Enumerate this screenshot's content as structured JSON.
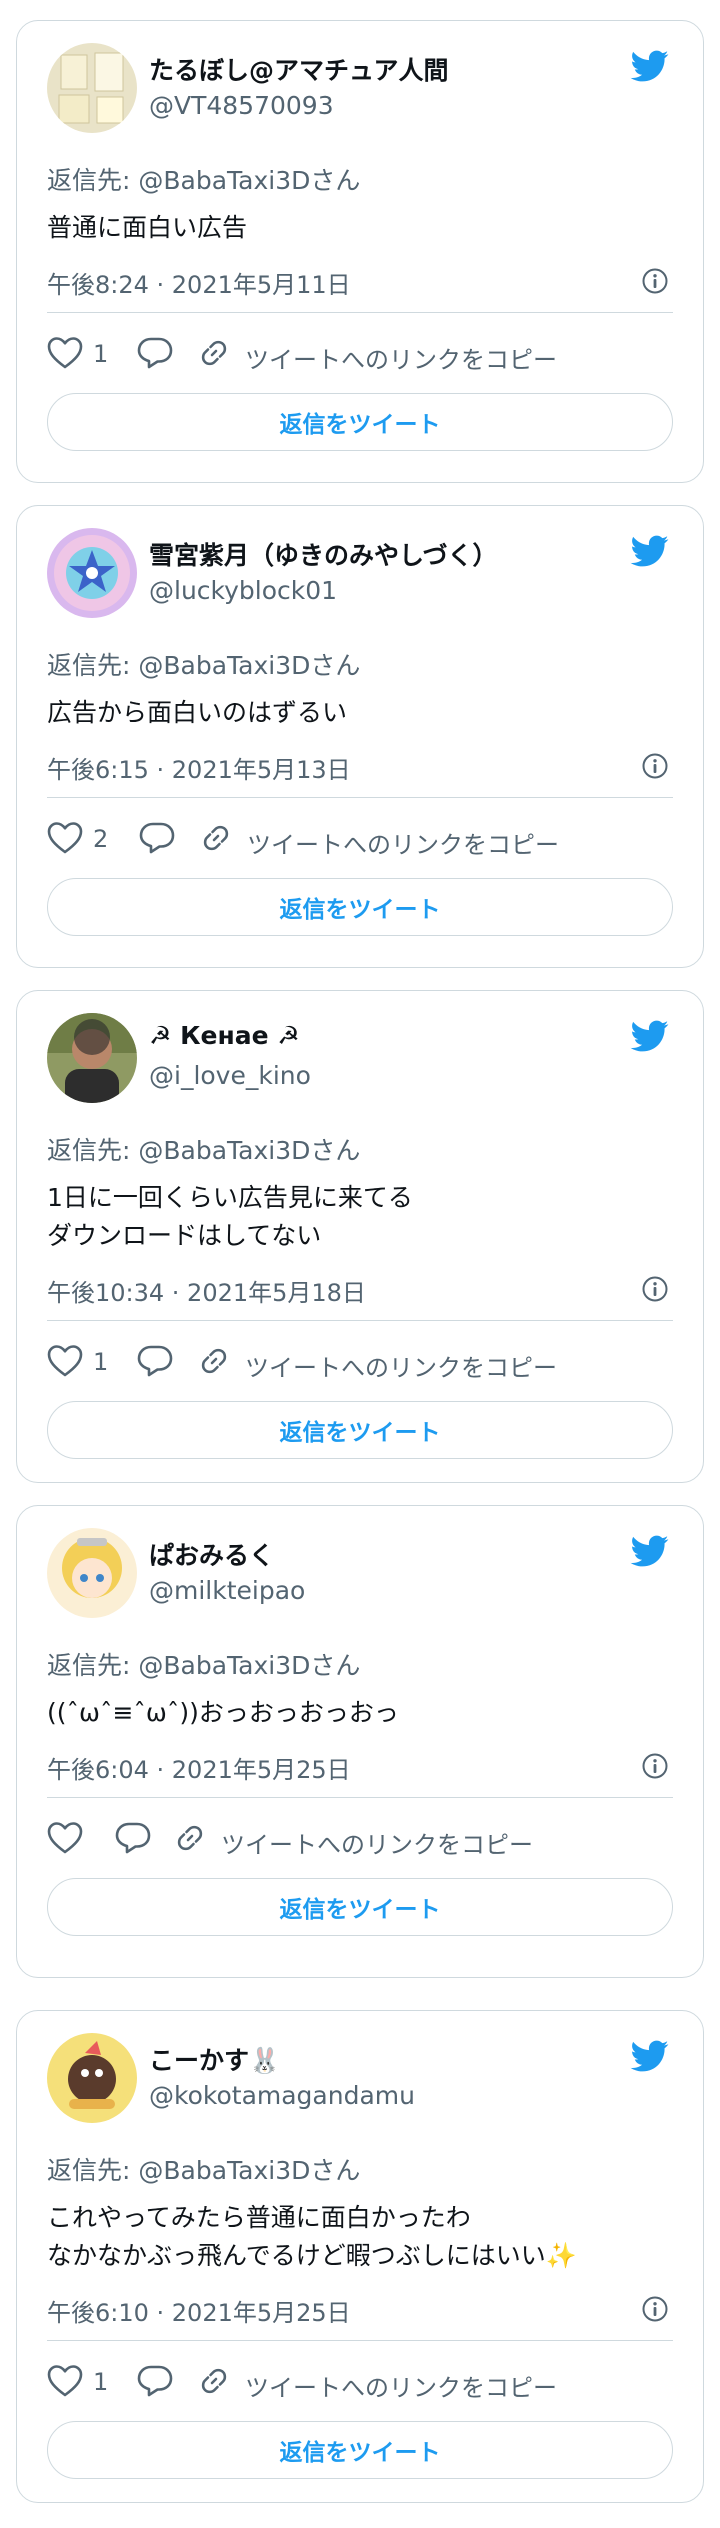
{
  "colors": {
    "accent": "#1d9bf0",
    "text": "#0f1419",
    "muted": "#536471",
    "border": "#cfd9de"
  },
  "icons": {
    "bird": "twitter-bird-icon",
    "info": "info-icon",
    "like": "heart-icon",
    "reply": "speech-bubble-icon",
    "link": "link-chain-icon"
  },
  "labels": {
    "reply_prefix": "返信先: ",
    "reply_suffix": "さん",
    "copy_link": "ツイートへのリンクをコピー",
    "reply_button": "返信をツイート"
  },
  "tweets": [
    {
      "display_name": "たるぼし@アマチュア人間",
      "handle": "@VT48570093",
      "reply_to": "@BabaTaxi3D",
      "text_lines": [
        "普通に面白い広告"
      ],
      "timestamp": "午後8:24 · 2021年5月11日",
      "like_count": "1"
    },
    {
      "display_name": "雪宮紫月（ゆきのみやしづく）",
      "handle": "@luckyblock01",
      "reply_to": "@BabaTaxi3D",
      "text_lines": [
        "広告から面白いのはずるい"
      ],
      "timestamp": "午後6:15 · 2021年5月13日",
      "like_count": "2"
    },
    {
      "display_name": "☭ Кенае ☭",
      "handle": "@i_love_kino",
      "reply_to": "@BabaTaxi3D",
      "text_lines": [
        "1日に一回くらい広告見に来てる",
        "ダウンロードはしてない"
      ],
      "timestamp": "午後10:34 · 2021年5月18日",
      "like_count": "1"
    },
    {
      "display_name": "ぱおみるく",
      "handle": "@milkteipao",
      "reply_to": "@BabaTaxi3D",
      "text_lines": [
        "((ˆωˆ≡ˆωˆ))おっおっおっおっ"
      ],
      "timestamp": "午後6:04 · 2021年5月25日",
      "like_count": ""
    },
    {
      "display_name": "こーかす🐰",
      "handle": "@kokotamagandamu",
      "reply_to": "@BabaTaxi3D",
      "text_lines": [
        "これやってみたら普通に面白かったわ",
        "なかなかぶっ飛んでるけど暇つぶしにはいい✨"
      ],
      "timestamp": "午後6:10 · 2021年5月25日",
      "like_count": "1"
    }
  ]
}
